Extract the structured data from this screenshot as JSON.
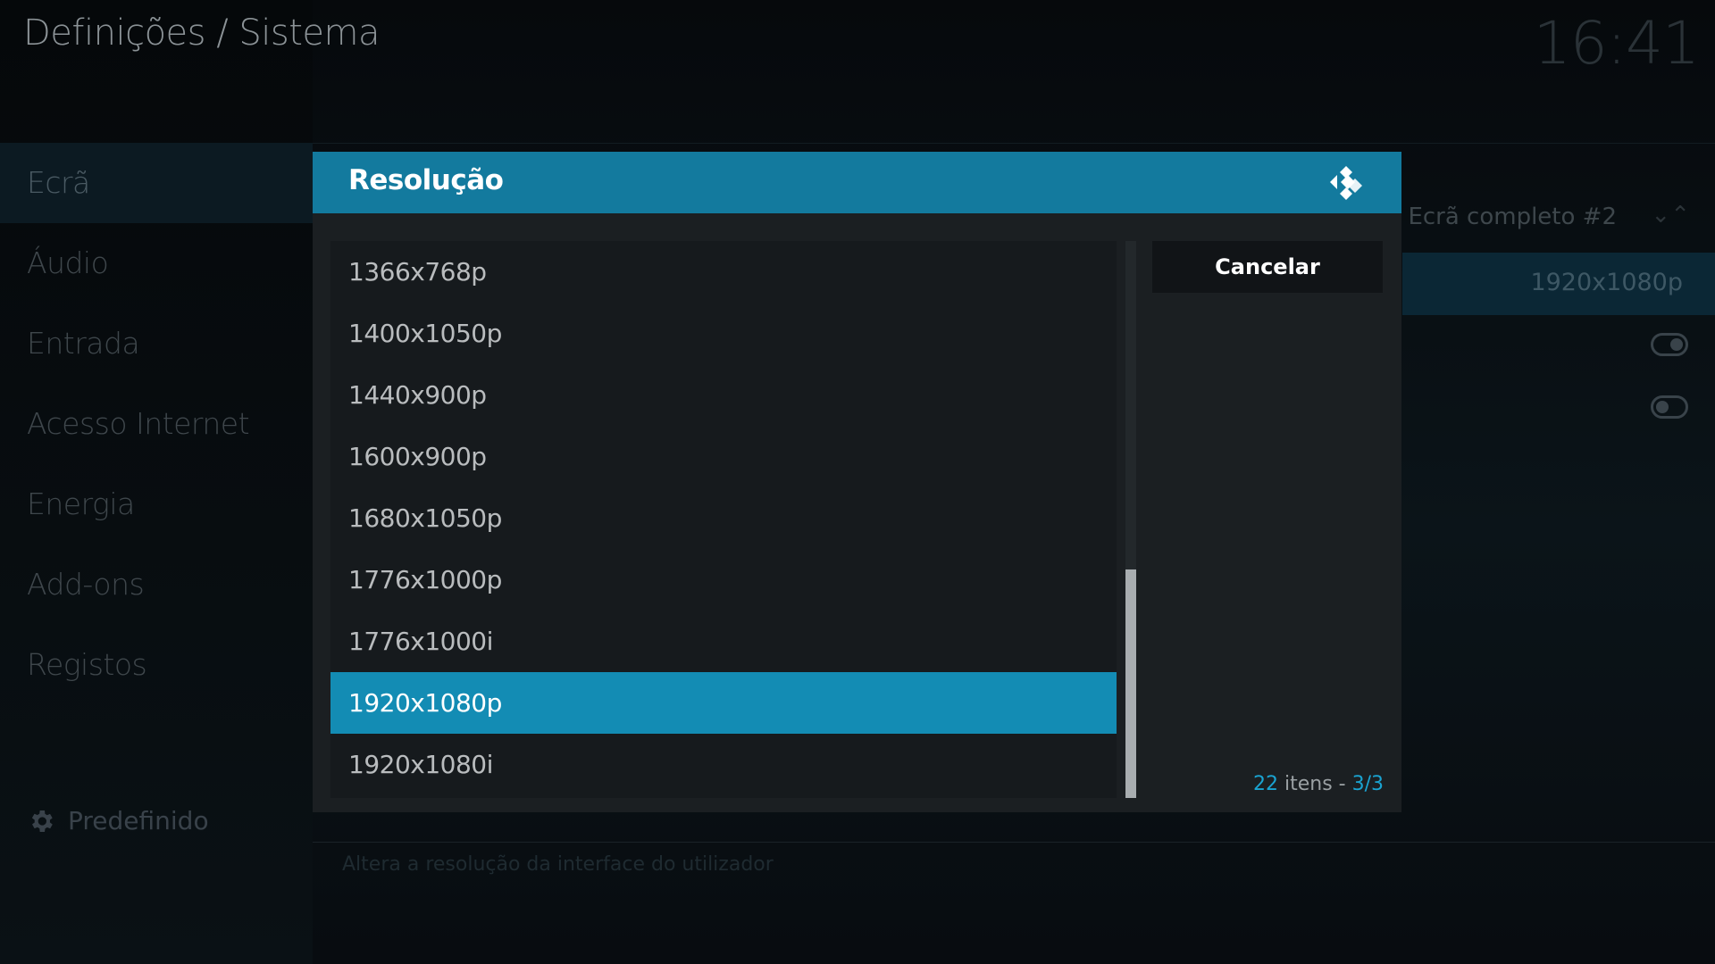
{
  "header": {
    "title": "Definições / Sistema",
    "clock": "16:41"
  },
  "sidebar": {
    "items": [
      {
        "label": "Ecrã",
        "active": true
      },
      {
        "label": "Áudio"
      },
      {
        "label": "Entrada"
      },
      {
        "label": "Acesso Internet"
      },
      {
        "label": "Energia"
      },
      {
        "label": "Add-ons"
      },
      {
        "label": "Registos"
      }
    ],
    "preset_label": "Predefinido"
  },
  "background_settings": {
    "display_mode": "Ecrã completo #2",
    "resolution_value": "1920x1080p",
    "hint": "Altera a resolução da interface do utilizador"
  },
  "dialog": {
    "title": "Resolução",
    "cancel_label": "Cancelar",
    "items": [
      "1366x768p",
      "1400x1050p",
      "1440x900p",
      "1600x900p",
      "1680x1050p",
      "1776x1000p",
      "1776x1000i",
      "1920x1080p",
      "1920x1080i"
    ],
    "selected_index": 7,
    "count": "22",
    "count_suffix": " itens - ",
    "page": "3/3",
    "scroll_position": 0.59
  },
  "colors": {
    "accent": "#138cb4",
    "header": "#137a9e"
  }
}
